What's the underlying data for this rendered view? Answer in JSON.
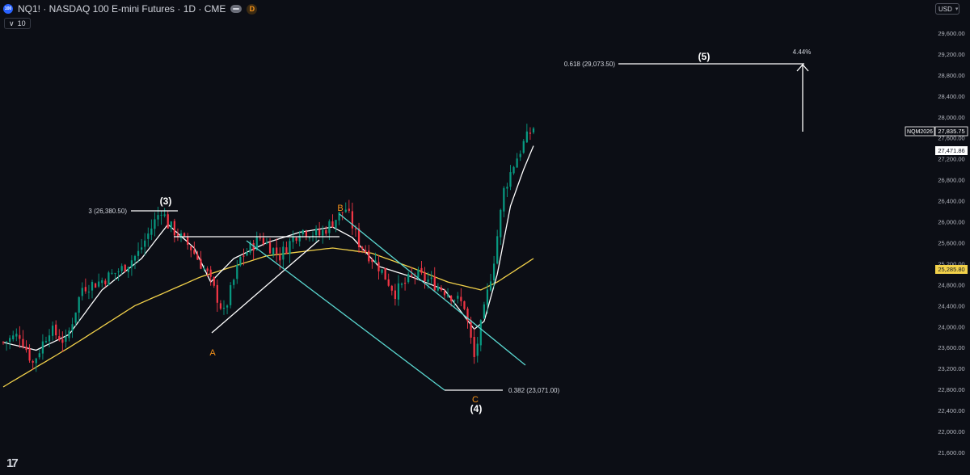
{
  "header": {
    "symbol_badge": "100",
    "title": "NQ1! · NASDAQ 100 E-mini Futures · 1D · CME",
    "badge": "D",
    "volume_chevron": "∨",
    "volume_value": "10",
    "currency": "USD"
  },
  "logo": "17",
  "colors": {
    "background": "#0c0e15",
    "up_candle": "#089981",
    "down_candle": "#f23645",
    "ema_fast": "#ffffff",
    "ema_slow": "#f2d14a",
    "channel": "#5ad7d0",
    "wave_label_letter": "#f7931a",
    "wave_label_number": "#ffffff"
  },
  "chart_data": {
    "type": "candlestick",
    "instrument": "NQ1!",
    "interval": "1D",
    "ylim": [
      21600,
      29800
    ],
    "y_ticks": [
      "21,600.00",
      "22,000.00",
      "22,400.00",
      "22,800.00",
      "23,200.00",
      "23,600.00",
      "24,000.00",
      "24,400.00",
      "24,800.00",
      "25,200.00",
      "25,600.00",
      "26,000.00",
      "26,400.00",
      "26,800.00",
      "27,200.00",
      "27,600.00",
      "28,000.00",
      "28,400.00",
      "28,800.00",
      "29,200.00",
      "29,600.00"
    ],
    "num_bars": 162,
    "price_anchors": [
      [
        0,
        23700
      ],
      [
        5,
        23850
      ],
      [
        9,
        23300
      ],
      [
        14,
        23950
      ],
      [
        19,
        23700
      ],
      [
        24,
        24750
      ],
      [
        29,
        24850
      ],
      [
        36,
        25100
      ],
      [
        41,
        25400
      ],
      [
        48,
        26250
      ],
      [
        50,
        25950
      ],
      [
        57,
        25500
      ],
      [
        62,
        25000
      ],
      [
        67,
        24250
      ],
      [
        72,
        25300
      ],
      [
        78,
        25700
      ],
      [
        84,
        25350
      ],
      [
        90,
        25850
      ],
      [
        96,
        25750
      ],
      [
        104,
        26250
      ],
      [
        108,
        25600
      ],
      [
        114,
        25150
      ],
      [
        119,
        24650
      ],
      [
        125,
        25000
      ],
      [
        130,
        24850
      ],
      [
        135,
        24650
      ],
      [
        140,
        24400
      ],
      [
        143,
        23400
      ],
      [
        146,
        24300
      ],
      [
        149,
        25300
      ],
      [
        152,
        26600
      ],
      [
        155,
        27100
      ],
      [
        158,
        27500
      ],
      [
        161,
        27800
      ]
    ],
    "ema_fast_anchors": [
      [
        0,
        23700
      ],
      [
        10,
        23550
      ],
      [
        20,
        23850
      ],
      [
        30,
        24700
      ],
      [
        42,
        25300
      ],
      [
        50,
        25950
      ],
      [
        58,
        25500
      ],
      [
        63,
        24850
      ],
      [
        70,
        25300
      ],
      [
        80,
        25600
      ],
      [
        90,
        25800
      ],
      [
        100,
        25900
      ],
      [
        106,
        25700
      ],
      [
        114,
        25150
      ],
      [
        124,
        24950
      ],
      [
        134,
        24700
      ],
      [
        140,
        24200
      ],
      [
        143,
        23950
      ],
      [
        146,
        24100
      ],
      [
        150,
        25000
      ],
      [
        154,
        26300
      ],
      [
        158,
        27000
      ],
      [
        161,
        27450
      ]
    ],
    "ema_slow_anchors": [
      [
        0,
        22850
      ],
      [
        20,
        23600
      ],
      [
        40,
        24400
      ],
      [
        60,
        24950
      ],
      [
        80,
        25350
      ],
      [
        100,
        25500
      ],
      [
        112,
        25400
      ],
      [
        125,
        25100
      ],
      [
        135,
        24850
      ],
      [
        145,
        24700
      ],
      [
        150,
        24850
      ],
      [
        161,
        25300
      ]
    ],
    "last_values": [
      {
        "label": "NQM2026",
        "value": "27,835.75",
        "style": "outline"
      },
      {
        "value": "27,471.86",
        "style": "white"
      },
      {
        "value": "25,285.80",
        "style": "yellow"
      }
    ],
    "levels": [
      {
        "label": "3 (26,380.50)",
        "price": 26380.5
      },
      {
        "label": "0.382 (23,071.00)",
        "price": 23071
      },
      {
        "label": "0.618 (29,073.50)",
        "price": 29073.5
      }
    ],
    "wave_labels": [
      {
        "text": "(3)",
        "kind": "number"
      },
      {
        "text": "A",
        "kind": "letter"
      },
      {
        "text": "B",
        "kind": "letter"
      },
      {
        "text": "C",
        "kind": "letter"
      },
      {
        "text": "(4)",
        "kind": "number"
      },
      {
        "text": "(5)",
        "kind": "number"
      }
    ],
    "projection_percent": "4.44%"
  }
}
